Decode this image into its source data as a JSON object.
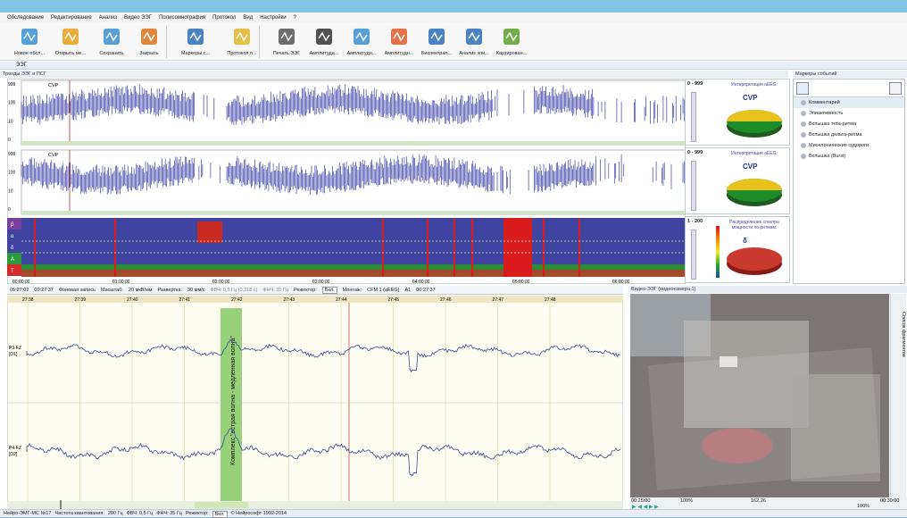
{
  "menu": [
    "Обследование",
    "Редактирование",
    "Анализ",
    "Видео ЭЭГ",
    "Полисомнография",
    "Протокол",
    "Вид",
    "Настройки",
    "?"
  ],
  "toolbar": [
    {
      "label": "Новое обсл...",
      "icon": "new-exam-icon",
      "color": "#3b8fd4"
    },
    {
      "label": "Открыть ме...",
      "icon": "open-icon",
      "color": "#e7a21a"
    },
    {
      "label": "Сохранить",
      "icon": "save-icon",
      "color": "#3b8fd4"
    },
    {
      "label": "Закрыть",
      "icon": "close-exam-icon",
      "color": "#d9731c"
    },
    {
      "label": "Маркеры с...",
      "icon": "markers-icon",
      "color": "#2a6fb8"
    },
    {
      "label": "Протокол п...",
      "icon": "protocol-icon",
      "color": "#e1b62c"
    },
    {
      "label": "Печать ЭЭГ",
      "icon": "printer-icon",
      "color": "#555"
    },
    {
      "label": "Амплитуда...",
      "icon": "amplitude-icon",
      "color": "#333"
    },
    {
      "label": "Амплитудн...",
      "icon": "amplitude-table-icon",
      "color": "#3b8fd4"
    },
    {
      "label": "Амплитудн...",
      "icon": "amplitude-map-icon",
      "color": "#e25b2a"
    },
    {
      "label": "Биспектрал...",
      "icon": "bispectral-icon",
      "color": "#2a6fb8"
    },
    {
      "label": "Анализ эпи...",
      "icon": "epi-analysis-icon",
      "color": "#2a6fb8"
    },
    {
      "label": "Картирован...",
      "icon": "mapping-icon",
      "color": "#5aa12a"
    }
  ],
  "eeg_section": "ЭЭГ",
  "trends": {
    "title": "Тренды ЭЭГ и ПСГ",
    "ch1_label": "CVP",
    "ch2_label": "CVP",
    "yticks": [
      "999",
      "100",
      "10",
      "0"
    ],
    "time_ticks": [
      "00:00:00",
      "01:00:00",
      "02:00:00",
      "03:00:00",
      "04:00:00",
      "05:00:00",
      "06:00:00"
    ],
    "spectral_bands": [
      "β",
      "α",
      "δ",
      "A",
      "T"
    ],
    "side": [
      {
        "range": "0 - 999",
        "sub": "999",
        "label": "Интерпретация aEEG:",
        "value": "CVP"
      },
      {
        "range": "0 - 999",
        "sub": "999",
        "label": "Интерпретация aEEG:",
        "value": "CVP"
      },
      {
        "range": "1 - 200",
        "sub": "1000",
        "label": "Распределение спектра мощности по ритмам:",
        "value": "δ"
      }
    ]
  },
  "markers": {
    "title": "Маркеры событий",
    "items": [
      "Комментарий",
      "Эпиактивность",
      "Вспышка тета-ритма",
      "Вспышка дельта-ритма",
      "Миоклонические судороги",
      "Вспышка (Burst)"
    ]
  },
  "eegbar": {
    "time": "05:27:02",
    "elapsed": "00:27:37",
    "mode": "Фоновая запись",
    "scale_label": "Масштаб:",
    "scale": "20 мкВ/мм",
    "sweep_label": "Развертка:",
    "sweep": "30 мм/с",
    "lpf": "ФВЧ: 0,5 Гц (0,318 с)",
    "hpf": "ФНЧ: 35 Гц",
    "notch_label": "Режектор:",
    "notch": "Вкл.",
    "montage_label": "Монтаж:",
    "montage": "CFM 1 (aEEG)",
    "ref": "A1",
    "clock": "00:27:37"
  },
  "eeg": {
    "ticks": [
      "27:38",
      "27:39",
      "27:40",
      "27:41",
      "27:42",
      "27:43",
      "27:44",
      "27:45",
      "27:46",
      "27:47",
      "27:48"
    ],
    "top_ticks": [
      "27:38",
      "27:39",
      "27:40",
      "27:41",
      "27:42",
      "27:43",
      "27:44",
      "27:45",
      "27:46",
      "27:47",
      "27:48"
    ],
    "ch1": [
      "P3-FZ",
      "[O1]"
    ],
    "ch2": [
      "P4-FZ",
      "[O2]"
    ],
    "annotation": "Комплекс \"острая волна - медленная волна\""
  },
  "video": {
    "title": "Видео-ЭЭГ (видеокамера 1)",
    "side_tab": "Список фрагментов",
    "t0": "00:25:00",
    "vol": "100%",
    "t1": "162,26",
    "t2": "00:30:00",
    "zoom": "100%"
  },
  "status": {
    "device": "Нейро-ЭМГ-МС №17",
    "rate_label": "Частота квантования:",
    "rate": "200 Гц",
    "lpf": "ФВЧ: 0,5 Гц",
    "hpf": "ФНЧ: 35 Гц",
    "notch_label": "Режектор:",
    "notch": "Вкл.",
    "copy": "© Нейрософт 1992-2014"
  }
}
